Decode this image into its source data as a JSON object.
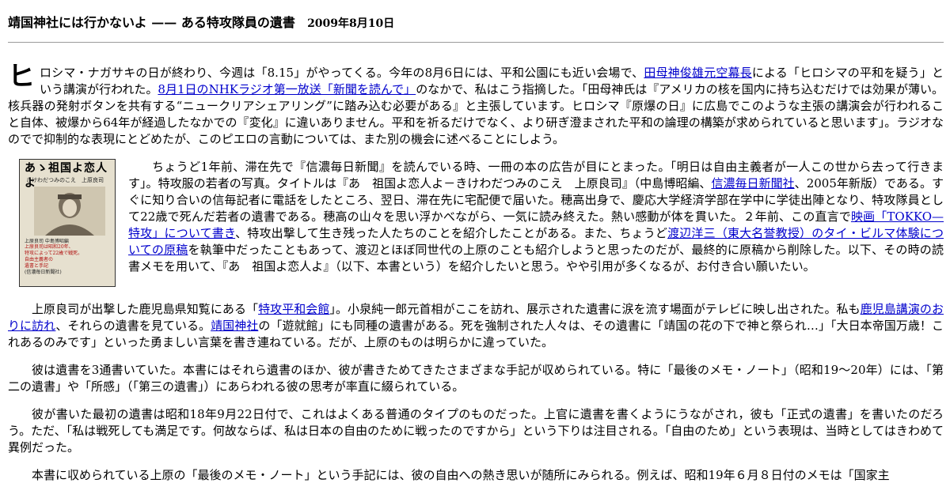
{
  "header": {
    "title": "靖国神社には行かないよ —— ある特攻隊員の遺書",
    "date": "2009年8月10日"
  },
  "para1": {
    "dropcap": "ヒ",
    "t1": "ロシマ・ナガサキの日が終わり、今週は「8.15」がやってくる。今年の8月6日には、平和公園にも近い会場で、",
    "link1": "田母神俊雄元空幕長",
    "t2": "による「ヒロシマの平和を疑う」という講演が行われた。",
    "link2": "8月1日のNHKラジオ第一放送「新聞を読んで」",
    "t3": "のなかで、私はこう指摘した。「田母神氏は『アメリカの核を国内に持ち込むだけでは効果が薄い。核兵器の発射ボタンを共有する“ニュークリアシェアリング”に踏み込む必要がある』と主張しています。ヒロシマ『原爆の日』に広島でこのような主張の講演会が行われること自体、被爆から64年が経過したなかでの『変化』に違いありません。平和を祈るだけでなく、より研ぎ澄まされた平和の論理の構築が求められていると思います」。ラジオなのでで抑制的な表現にとどめたが、このピエロの言動については、また別の機会に述べることにしよう。"
  },
  "book": {
    "title": "あゝ祖国よ恋人よ",
    "subtitle": "きけわだつみのこえ　上原良司",
    "lines": [
      "上原良司 中島博昭編",
      "上原良司は昭和20年、",
      "特攻によって22歳で戦死。",
      "自由主義者の",
      "遺書と手記",
      "(信濃毎日新聞社)"
    ]
  },
  "para2": {
    "t1": "ちょうど1年前、滞在先で『信濃毎日新聞』を読んでいる時、一冊の本の広告が目にとまった。「明日は自由主義者が一人この世から去って行きます」。特攻服の若者の写真。タイトルは『あ　祖国よ恋人よ－きけわだつみのこえ　上原良司』（中島博昭編、",
    "link1": "信濃毎日新聞社",
    "t2": "、2005年新版）である。すぐに知り合いの信毎記者に電話をしたところ、翌日、滞在先に宅配便で届いた。穂高出身で、慶応大学経済学部在学中に学徒出陣となり、特攻隊員として22歳で死んだ若者の遺書である。穂高の山々を思い浮かべながら、一気に読み終えた。熱い感動が体を貫いた。２年前、この直言で",
    "link2": "映画「TOKKO—特攻」について書き",
    "t3": "、特攻出撃して生き残った人たちのことを紹介したことがある。また、ちょうど",
    "link3": "渡辺洋三（東大名誉教授）のタイ・ビルマ体験についての原稿",
    "t4": "を執筆中だったこともあって、渡辺とほぼ同世代の上原のことも紹介しようと思ったのだが、最終的に原稿から削除した。以下、その時の読書メモを用いて、『あ　祖国よ恋人よ』（以下、本書という）を紹介したいと思う。やや引用が多くなるが、お付き合い願いたい。"
  },
  "para3": {
    "t1": "上原良司が出撃した鹿児島県知覧にある「",
    "link1": "特攻平和会館",
    "t2": "」。小泉純一郎元首相がここを訪れ、展示された遺書に涙を流す場面がテレビに映し出された。私も",
    "link2": "鹿児島講演のおりに訪れ",
    "t3": "、それらの遺書を見ている。",
    "link3": "靖国神社",
    "t4": "の「遊就館」にも同種の遺書がある。死を強制された人々は、その遺書に「靖国の花の下で神と祭られ…」「大日本帝国万歳！これあるのみです」といった勇ましい言葉を書き連ねている。だが、上原のものは明らかに違っていた。"
  },
  "para4": {
    "text": "彼は遺書を3通書いていた。本書にはそれら遺書のほか、彼が書きためてきたさまざまな手記が収められている。特に「最後のメモ・ノート」（昭和19～20年）には、「第二の遺書」や「所感」（「第三の遺書」）にあらわれる彼の思考が率直に綴られている。"
  },
  "para5": {
    "text": "彼が書いた最初の遺書は昭和18年9月22日付で、これはよくある普通のタイプのものだった。上官に遺書を書くようにうながされ，彼も「正式の遺書」を書いたのだろう。ただ、「私は戦死しても満足です。何故ならば、私は日本の自由のために戦ったのですから」という下りは注目される。「自由のため」という表現は、当時としてはきわめて異例だった。"
  },
  "para6": {
    "text": "本書に収められている上原の「最後のメモ・ノート」という手記には、彼の自由への熱き思いが随所にみられる。例えば、昭和19年６月８日付のメモは「国家主"
  }
}
